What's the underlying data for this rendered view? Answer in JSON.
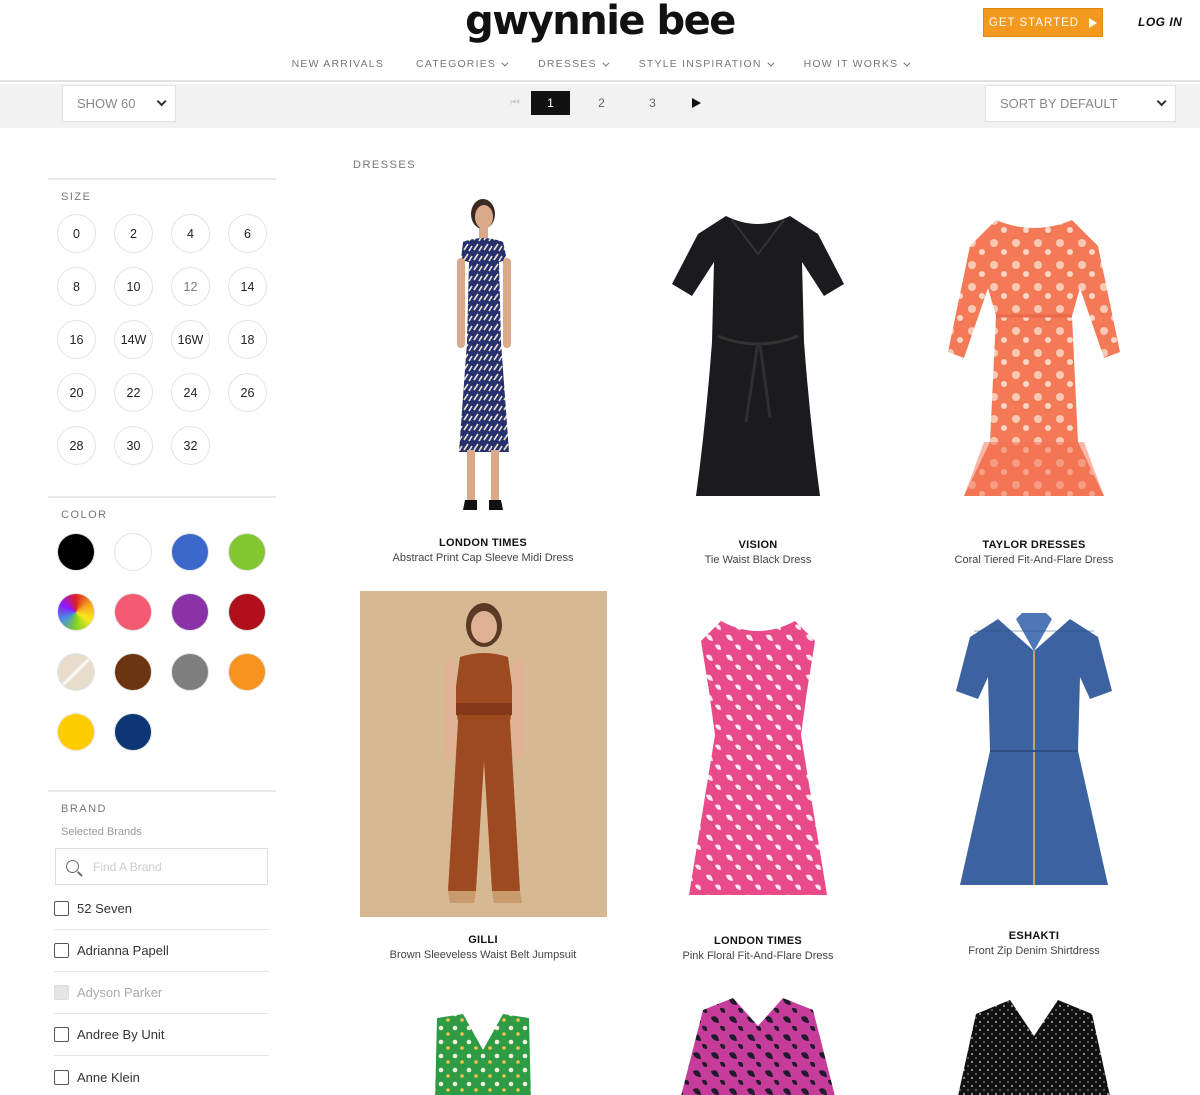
{
  "header": {
    "logo": "gwynnie bee",
    "get_started": "GET STARTED",
    "login": "LOG IN",
    "nav": [
      {
        "label": "NEW ARRIVALS",
        "dropdown": false
      },
      {
        "label": "CATEGORIES",
        "dropdown": true
      },
      {
        "label": "DRESSES",
        "dropdown": true
      },
      {
        "label": "STYLE INSPIRATION",
        "dropdown": true
      },
      {
        "label": "HOW IT WORKS",
        "dropdown": true
      }
    ]
  },
  "toolbar": {
    "show": "SHOW 60",
    "sort": "SORT BY DEFAULT",
    "pages": [
      "1",
      "2",
      "3"
    ],
    "current_page": "1"
  },
  "breadcrumb": "DRESSES",
  "filters": {
    "size_title": "SIZE",
    "sizes": [
      "0",
      "2",
      "4",
      "6",
      "8",
      "10",
      "12",
      "14",
      "16",
      "14W",
      "16W",
      "18",
      "20",
      "22",
      "24",
      "26",
      "28",
      "30",
      "32"
    ],
    "color_title": "COLOR",
    "colors": [
      "#000000",
      "#ffffff",
      "#3a67c9",
      "#84c831",
      "multicolor",
      "#f55a73",
      "#8a32a8",
      "#b0101b",
      "nude",
      "#6b3511",
      "#7f7f7f",
      "#f7931e",
      "#ffcc00",
      "#0c3675"
    ],
    "brand_title": "BRAND",
    "brand_subtitle": "Selected Brands",
    "brand_search_placeholder": "Find A Brand",
    "brands": [
      {
        "name": "52 Seven",
        "disabled": false
      },
      {
        "name": "Adrianna Papell",
        "disabled": false
      },
      {
        "name": "Adyson Parker",
        "disabled": true
      },
      {
        "name": "Andree By Unit",
        "disabled": false
      },
      {
        "name": "Anne Klein",
        "disabled": false
      }
    ]
  },
  "products": [
    {
      "brand": "LONDON TIMES",
      "name": "Abstract Print Cap Sleeve Midi Dress"
    },
    {
      "brand": "VISION",
      "name": "Tie Waist Black Dress"
    },
    {
      "brand": "TAYLOR DRESSES",
      "name": "Coral Tiered Fit-And-Flare Dress"
    },
    {
      "brand": "GILLI",
      "name": "Brown Sleeveless Waist Belt Jumpsuit"
    },
    {
      "brand": "LONDON TIMES",
      "name": "Pink Floral Fit-And-Flare Dress"
    },
    {
      "brand": "ESHAKTI",
      "name": "Front Zip Denim Shirtdress"
    },
    {
      "brand": "",
      "name": ""
    },
    {
      "brand": "",
      "name": ""
    },
    {
      "brand": "",
      "name": ""
    }
  ]
}
